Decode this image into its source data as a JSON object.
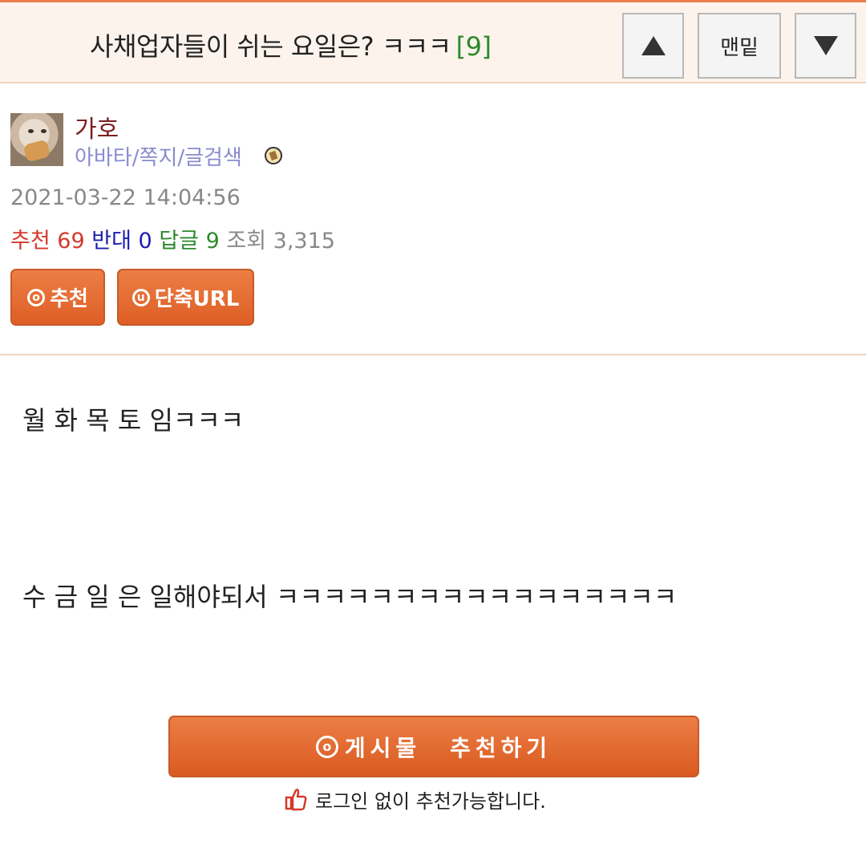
{
  "header": {
    "title": "사채업자들이 쉬는 요일은? ㅋㅋㅋ",
    "comment_count": "[9]",
    "nav_up_icon": "triangle-up-icon",
    "nav_bottom_label": "맨밑",
    "nav_down_icon": "triangle-down-icon",
    "accent_color": "#e8804a",
    "background_color": "#fcf3ec"
  },
  "author": {
    "name": "가호",
    "links": "아바타/쪽지/글검색",
    "avatar_icon": "cat-avatar-icon",
    "badge_icon": "member-badge-icon"
  },
  "post": {
    "date": "2021-03-22 14:04:56",
    "stats": {
      "up_label": "추천",
      "up_value": "69",
      "down_label": "반대",
      "down_value": "0",
      "reply_label": "답글",
      "reply_value": "9",
      "view_label": "조회",
      "view_value": "3,315"
    },
    "buttons": {
      "recommend_icon": "o",
      "recommend_label": "추천",
      "shorturl_icon": "u",
      "shorturl_label": "단축URL"
    },
    "body": [
      "월 화 목 토 임ㅋㅋㅋ",
      "수 금 일 은 일해야되서 ㅋㅋㅋㅋㅋㅋㅋㅋㅋㅋㅋㅋㅋㅋㅋㅋㅋ"
    ]
  },
  "footer": {
    "recommend_icon": "o",
    "recommend_label_1": "게시물",
    "recommend_label_2": "추천하기",
    "login_note_icon": "thumbs-up-icon",
    "login_note": "로그인 없이 추천가능합니다.",
    "button_color": "#de5f25"
  }
}
